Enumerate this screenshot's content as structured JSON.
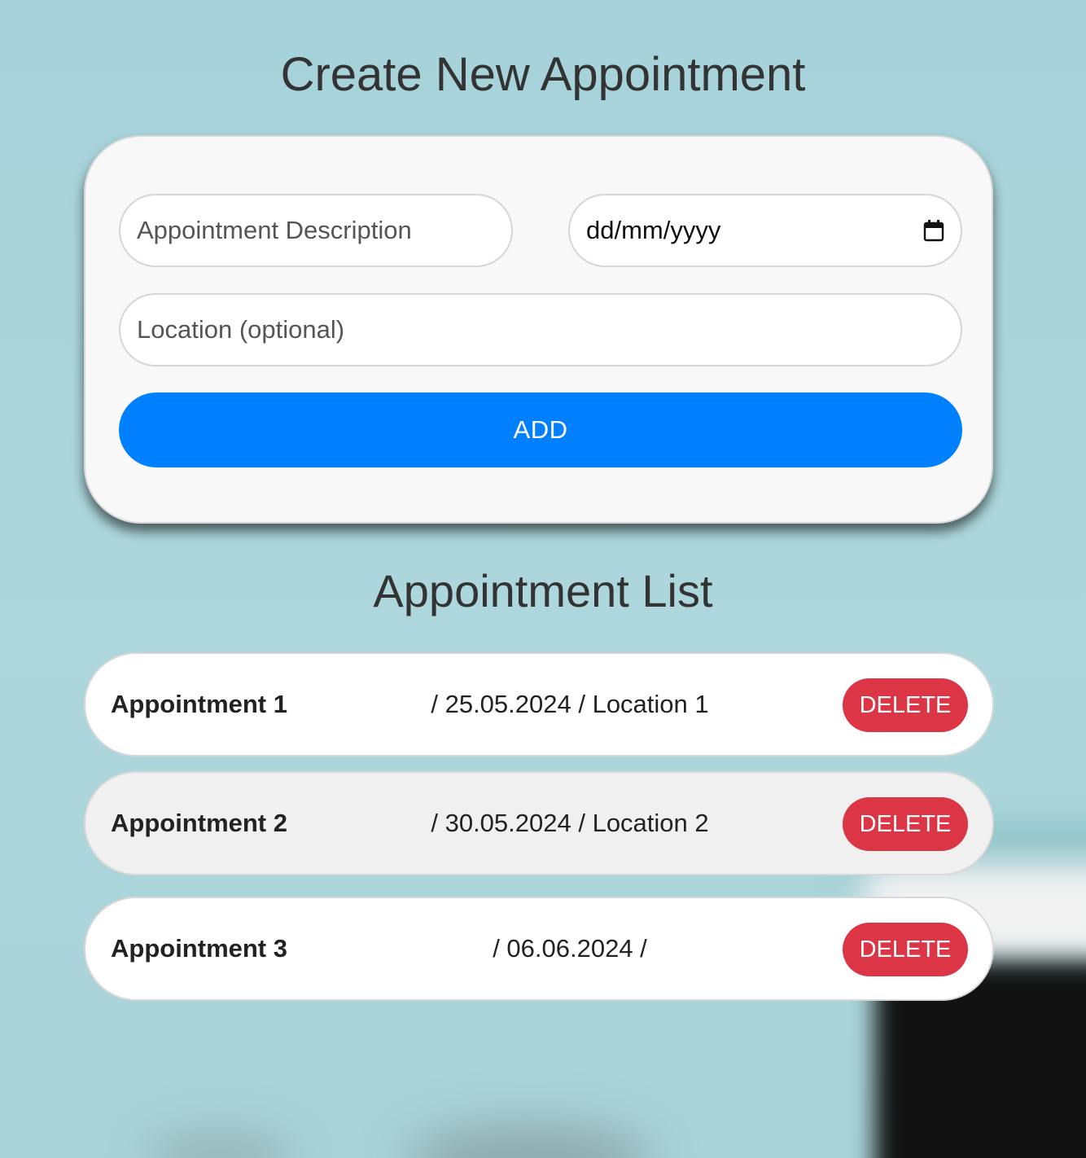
{
  "page": {
    "title": "Create New Appointment",
    "list_title": "Appointment List"
  },
  "form": {
    "description_placeholder": "Appointment Description",
    "date_placeholder": "dd/mm/yyyy",
    "date_icon": "calendar-icon",
    "location_placeholder": "Location (optional)",
    "add_label": "ADD"
  },
  "appointments": [
    {
      "name": "Appointment 1",
      "meta": "/ 25.05.2024 / Location 1",
      "delete_label": "DELETE"
    },
    {
      "name": "Appointment 2",
      "meta": "/ 30.05.2024 / Location 2",
      "delete_label": "DELETE"
    },
    {
      "name": "Appointment 3",
      "meta": "/ 06.06.2024 /",
      "delete_label": "DELETE"
    }
  ],
  "colors": {
    "accent": "#0080ff",
    "danger": "#dc3545",
    "background": "#a9d3da",
    "card": "#f8f8f8"
  }
}
